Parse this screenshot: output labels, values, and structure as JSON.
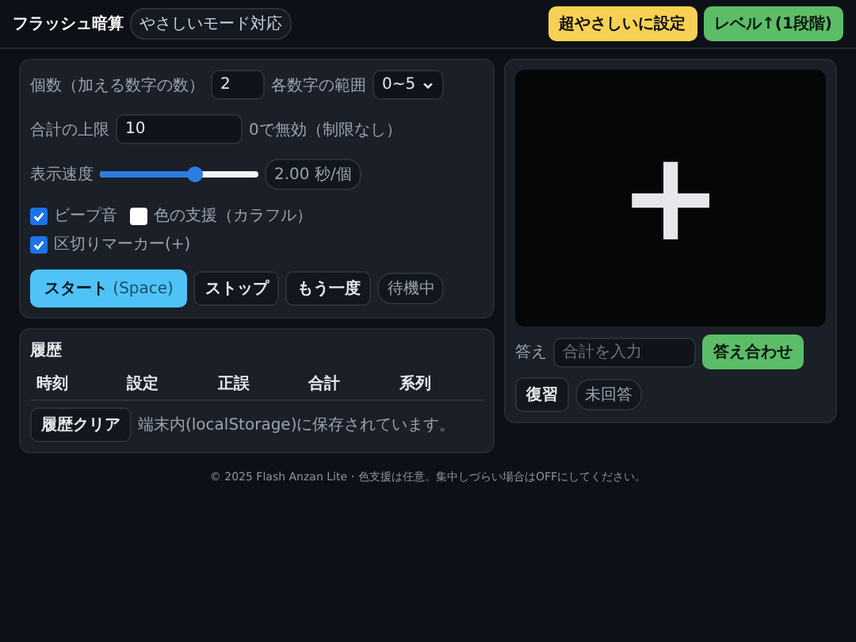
{
  "header": {
    "title": "フラッシュ暗算",
    "badge": "やさしいモード対応",
    "buttons": [
      {
        "label": "超やさしいに設定",
        "kind": "yellow"
      },
      {
        "label": "レベル↑(1段階)",
        "kind": "green"
      }
    ]
  },
  "settings": {
    "count_label": "個数（加える数字の数）",
    "count_value": "2",
    "range_label": "各数字の範囲",
    "range_value": "0~5",
    "limit_label": "合計の上限",
    "limit_value": "10",
    "limit_hint": "0で無効（制限なし）",
    "speed_label": "表示速度",
    "speed": {
      "level": 0.6
    },
    "speed_reading": "2.00 秒/個",
    "checks": [
      {
        "label": "ビープ音",
        "checked": true
      },
      {
        "label": "色の支援（カラフル）",
        "checked": false
      },
      {
        "label": "区切りマーカー(+)",
        "checked": true
      }
    ],
    "buttons": [
      {
        "label": "スタート",
        "hint": "(Space)",
        "kind": "primary"
      },
      {
        "label": "ストップ",
        "kind": "plain"
      },
      {
        "label": "もう一度",
        "kind": "plain"
      }
    ],
    "status": "待機中"
  },
  "display": {
    "text": "+",
    "answer_label": "答え",
    "answer_placeholder": "合計を入力",
    "check_button": "答え合わせ",
    "review_button": "復習",
    "result": "未回答"
  },
  "history": {
    "title": "履歴",
    "columns": [
      "時刻",
      "設定",
      "正誤",
      "合計",
      "系列"
    ],
    "clear_button": "履歴クリア",
    "note": "端末内(localStorage)に保存されています。"
  },
  "footer": "© 2025 Flash Anzan Lite・色支援は任意。集中しづらい場合はOFFにしてください。"
}
